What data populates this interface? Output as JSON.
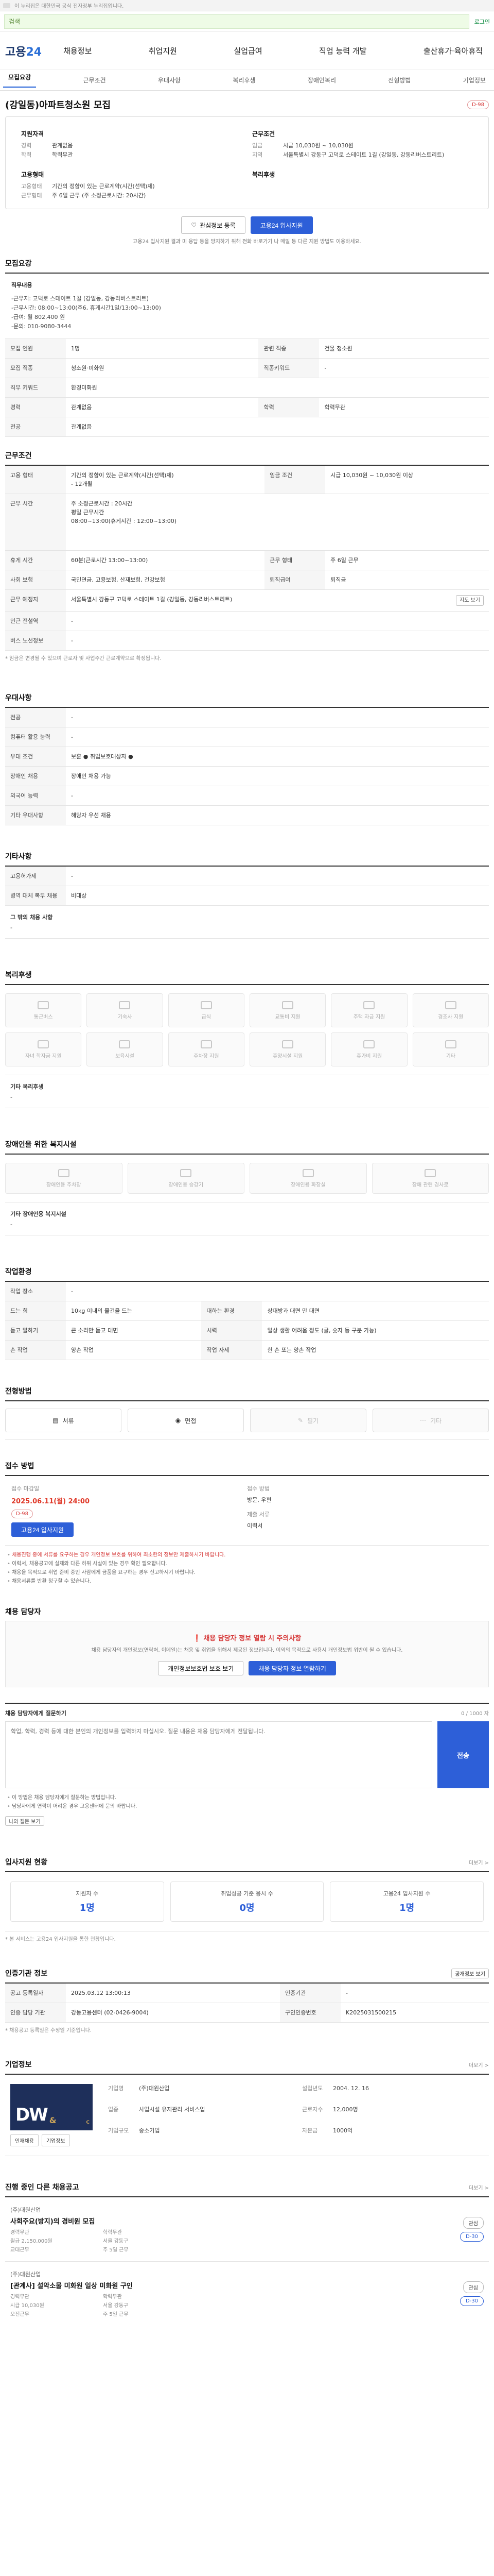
{
  "topbar": {
    "text": "이 누리집은 대한민국 공식 전자정부 누리집입니다."
  },
  "header": {
    "logo_main": "고용",
    "logo_accent": "24",
    "search_placeholder": "검색",
    "login_label": "로그인",
    "gnb": [
      "채용정보",
      "취업지원",
      "실업급여",
      "직업 능력 개발",
      "출산휴가·육아휴직"
    ]
  },
  "tabs": [
    "모집요강",
    "근무조건",
    "우대사항",
    "복리후생",
    "장애인복리",
    "전형방법",
    "기업정보"
  ],
  "job": {
    "title": "(강일동)아파트청소원 모집",
    "badge": "D-98",
    "summary": {
      "qualification_head": "지원자격",
      "qualification": [
        {
          "k": "경력",
          "v": "관계없음"
        },
        {
          "k": "학력",
          "v": "학력무관"
        }
      ],
      "employ_head": "고용형태",
      "employ": [
        {
          "k": "고용형태",
          "v": "기간의 정함이 있는 근로계약(시간(선택)제)"
        },
        {
          "k": "근무형태",
          "v": "주 6일 근무 (주 소정근로시간: 20시간)"
        }
      ],
      "work_head": "근무조건",
      "work": [
        {
          "k": "임금",
          "v": "시급 10,030원 ~ 10,030원"
        },
        {
          "k": "지역",
          "v": "서울특별시 강동구 고덕로 스테이트 1길 (강일동, 강동리버스트리트)"
        }
      ],
      "welfare_head": "복리후생",
      "welfare": []
    },
    "buttons": {
      "bookmark": "관심정보 등록",
      "apply": "고용24 입사지원"
    },
    "apply_note": "고용24 입사지원 결과 미 응답 등을 방지하기 위해 전화 바로가기 나 메일 등 다른 지원 방법도 이용하세요."
  },
  "recruit": {
    "title": "모집요강",
    "desc_title": "직무내용",
    "desc_lines": [
      "-근무지: 고덕로 스테이트 1길 (강일동, 강동리버스트리트)",
      "-근무시간: 08:00~13:00(주6, 휴게시간1일/13:00~13:00)",
      "-급여: 월 802,400 원",
      "-문의: 010-9080-3444"
    ],
    "rows": [
      {
        "k": "모집 인원",
        "v": "1명",
        "k2": "관련 직종",
        "v2": "건물 청소원"
      },
      {
        "k": "모집 직종",
        "v": "청소원·미화원",
        "k2": "직종키워드",
        "v2": "-"
      },
      {
        "k": "직무 키워드",
        "v": "환경미화원",
        "k2": "",
        "v2": ""
      },
      {
        "k": "경력",
        "v": "관계없음",
        "k2": "학력",
        "v2": "학력무관"
      },
      {
        "k": "전공",
        "v": "관계없음",
        "k2": "",
        "v2": ""
      }
    ]
  },
  "conditions": {
    "title": "근무조건",
    "rows": [
      {
        "k": "고용 형태",
        "v": "기간의 정함이 있는 근로계약(시간(선택)제)\n- 12개월",
        "k2": "임금 조건",
        "v2": "시급 10,030원 ~ 10,030원 이상"
      },
      {
        "k": "근무 시간",
        "v": "주 소정근로시간 : 20시간\n평일 근무시간\n08:00~13:00(휴게시간 : 12:00~13:00)",
        "k2": "",
        "v2": ""
      },
      {
        "k": "휴게 시간",
        "v": "60분(근로시간 13:00~13:00)",
        "k2": "근무 형태",
        "v2": "주 6일 근무"
      },
      {
        "k": "사회 보험",
        "v": "국민연금, 고용보험, 산재보험, 건강보험",
        "k2": "퇴직급여",
        "v2": "퇴직금"
      },
      {
        "k": "근무 예정지",
        "v": "서울특별시 강동구 고덕로 스테이트 1길 (강일동, 강동리버스트리트)",
        "k2": "",
        "v2": ""
      },
      {
        "k": "인근 전철역",
        "v": "-",
        "k2": "",
        "v2": ""
      },
      {
        "k": "버스 노선정보",
        "v": "-",
        "k2": "",
        "v2": ""
      }
    ],
    "map_button": "지도 보기",
    "note": "* 임금은 변경될 수 있으며 근로자 및 사업주간 근로계약으로 확정됩니다."
  },
  "preferences": {
    "title": "우대사항",
    "rows": [
      {
        "k": "전공",
        "v": "-"
      },
      {
        "k": "컴퓨터 활용 능력",
        "v": "-"
      },
      {
        "k": "우대 조건",
        "v": "보훈 ● 취업보호대상자 ●"
      },
      {
        "k": "장애인 채용",
        "v": "장애인 채용 가능"
      },
      {
        "k": "외국어 능력",
        "v": "-"
      },
      {
        "k": "기타 우대사항",
        "v": "해당자 우선 채용"
      }
    ]
  },
  "other": {
    "title": "기타사항",
    "rows": [
      {
        "k": "고용허가제",
        "v": "-"
      },
      {
        "k": "병역 대체 복무 채용",
        "v": "비대상"
      }
    ],
    "note_title": "그 밖의 채용 사항",
    "note_body": "-"
  },
  "welfare": {
    "title": "복리후생",
    "items": [
      "통근버스",
      "기숙사",
      "급식",
      "교통비 지원",
      "주택 자금 지원",
      "경조사 지원",
      "자녀 학자금 지원",
      "보육시설",
      "주차장 지원",
      "휴양시설 지원",
      "휴가비 지원",
      "기타"
    ],
    "etc_title": "기타 복리후생",
    "etc_body": "-"
  },
  "disability": {
    "title": "장애인을 위한 복지시설",
    "items": [
      "장애인용 주차장",
      "장애인용 승강기",
      "장애인용 화장실",
      "장애 관련 경사로"
    ],
    "etc_title": "기타 장애인용 복지시설",
    "etc_body": "-"
  },
  "environment": {
    "title": "작업환경",
    "rows": [
      {
        "k": "작업 장소",
        "v": "-",
        "k2": "",
        "v2": ""
      },
      {
        "k": "드는 힘",
        "v": "10kg 이내의 물건을 드는",
        "k2": "대하는 환경",
        "v2": "상대방과 대면 만 대면"
      },
      {
        "k": "듣고 말하기",
        "v": "큰 소리만 듣고 대면",
        "k2": "시력",
        "v2": "일상 생활 어려움 정도 (글, 숫자 등 구분 가능)"
      },
      {
        "k": "손 작업",
        "v": "양손 작업",
        "k2": "작업 자세",
        "v2": "한 손 또는 양손 작업"
      }
    ]
  },
  "selection": {
    "title": "전형방법",
    "steps": [
      "서류",
      "면접",
      "필기",
      "기타"
    ]
  },
  "apply": {
    "title": "접수 방법",
    "deadline_label": "접수 마감일",
    "deadline": "2025.06.11(월) 24:00",
    "apply_button": "고용24 입사지원",
    "method_label": "접수 방법",
    "method": "방문, 우편",
    "docs_label": "제출 서류",
    "docs": "이력서",
    "bullets": [
      "채용진행 중에 서류를 요구하는 경우 개인정보 보호를 위하여 최소한의 정보만 제출하시기 바랍니다.",
      "이력서, 채용공고에 실제와 다른 허위 사실이 있는 경우 확인 필요합니다.",
      "채용을 목적으로 취업 준비 중인 사람에게 금품을 요구하는 경우 신고하시기 바랍니다.",
      "채용서류를 반환 청구할 수 있습니다."
    ]
  },
  "manager": {
    "title": "채용 담당자",
    "warn": "채용 담당자 정보 열람 시 주의사항",
    "warn_sub": "채용 담당자의 개인정보(연락처, 이메일)는 채용 및 취업을 위해서 제공된 정보입니다. 이외의 목적으로 사용시 개인정보법 위반이 될 수 있습니다.",
    "btn_check": "개인정보보호법 보호 보기",
    "btn_view": "채용 담당자 정보 열람하기"
  },
  "inquiry": {
    "title": "채용 담당자에게 질문하기",
    "count": "0 / 1000 자",
    "placeholder": "학업, 학력, 경력 등에 대한 본인의 개인정보를 입력하지 마십시오. 질문 내용은 채용 담당자에게 전달됩니다.",
    "send": "전송",
    "bullets": [
      "이 방법은 채용 담당자에게 질문하는 방법입니다.",
      "담당자에게 연락이 어려운 경우 고용센터에 문의 바랍니다."
    ],
    "btn_mine": "나의 질문 보기"
  },
  "status": {
    "title": "입사지원 현황",
    "more": "더보기 >",
    "cards": [
      {
        "label": "지원자 수",
        "value": "1명"
      },
      {
        "label": "취업성공 기준 응시 수",
        "value": "0명"
      },
      {
        "label": "고용24 입사지원 수",
        "value": "1명"
      }
    ],
    "note": "* 본 서비스는 고용24 입사지원을 통한 현황입니다."
  },
  "cert": {
    "title": "인증기관 정보",
    "btn": "공개정보 보기",
    "rows": [
      {
        "k": "공고 등록일자",
        "v": "2025.03.12 13:00:13",
        "k2": "인증기관",
        "v2": "-"
      },
      {
        "k": "인증 담당 기관",
        "v": "강동고용센터 (02-0426-9004)",
        "k2": "구인인증번호",
        "v2": "K2025031500215"
      }
    ],
    "note": "* 채용공고 등록일은 수정일 기준입니다."
  },
  "company": {
    "title": "기업정보",
    "more": "더보기 >",
    "logo_text": "DW",
    "logo_amp": "&",
    "logo_tag": "C",
    "fields": [
      {
        "k": "기업명",
        "v": "(주)대원산업"
      },
      {
        "k": "설립년도",
        "v": "2004. 12. 16"
      },
      {
        "k": "업종",
        "v": "사업시설 유지관리 서비스업"
      },
      {
        "k": "근로자수",
        "v": "12,000명"
      },
      {
        "k": "기업규모",
        "v": "중소기업"
      },
      {
        "k": "자본금",
        "v": "1000억"
      }
    ],
    "btn_1": "인재채용",
    "btn_2": "기업정보"
  },
  "others": {
    "title": "진행 중인 다른 채용공고",
    "more": "더보기 >",
    "jobs": [
      {
        "cname": "(주)대원산업",
        "title": "사회주요(방지)의 경비원 모집",
        "meta": [
          "경력무관",
          "학력무관",
          "월급 2,150,000원",
          "서울 강동구",
          "교대근무",
          "주 5일 근무"
        ],
        "b1": "관심",
        "b2": "D-30"
      },
      {
        "cname": "(주)대원산업",
        "title": "[관계사] 설악소물 미화원 일상 미화원 구인",
        "meta": [
          "경력무관",
          "학력무관",
          "시급 10,030원",
          "서울 강동구",
          "오전근무",
          "주 5일 근무"
        ],
        "b1": "관심",
        "b2": "D-30"
      }
    ]
  }
}
